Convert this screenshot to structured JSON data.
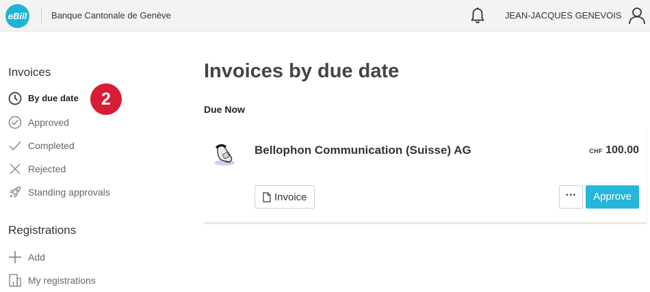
{
  "header": {
    "logo_text": "eBill",
    "bank_name": "Banque Cantonale de Genève",
    "user_name": "JEAN-JACQUES GENEVOIS",
    "accent_color": "#1fb3d5"
  },
  "sidebar": {
    "invoices_title": "Invoices",
    "invoices_items": [
      {
        "label": "By due date",
        "icon": "clock-icon",
        "active": true
      },
      {
        "label": "Approved",
        "icon": "approved-clock-icon"
      },
      {
        "label": "Completed",
        "icon": "checkmark-icon"
      },
      {
        "label": "Rejected",
        "icon": "x-icon"
      },
      {
        "label": "Standing approvals",
        "icon": "rocket-icon"
      }
    ],
    "registrations_title": "Registrations",
    "registrations_items": [
      {
        "label": "Add",
        "icon": "plus-icon"
      },
      {
        "label": "My registrations",
        "icon": "registrations-icon"
      }
    ]
  },
  "step_badge": "2",
  "main": {
    "title": "Invoices by due date",
    "section_label": "Due Now",
    "invoice": {
      "biller": "Bellophon Communication (Suisse) AG",
      "currency": "CHF",
      "amount": "100.00",
      "invoice_button": "Invoice",
      "more_button": "···",
      "approve_button": "Approve"
    }
  }
}
